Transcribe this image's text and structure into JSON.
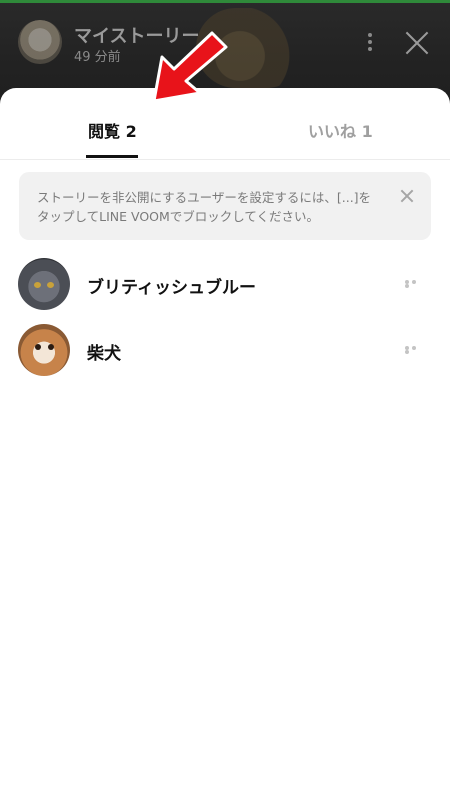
{
  "story": {
    "title": "マイストーリー",
    "time": "49 分前"
  },
  "tabs": [
    {
      "label": "閲覧 2",
      "selected": true
    },
    {
      "label": "いいね 1",
      "selected": false
    }
  ],
  "notice": {
    "text": "ストーリーを非公開にするユーザーを設定するには、[...]をタップしてLINE VOOMでブロックしてください。"
  },
  "viewers": [
    {
      "name": "ブリティッシュブルー",
      "avatar": "british-blue-cat"
    },
    {
      "name": "柴犬",
      "avatar": "shiba-dog"
    }
  ],
  "colors": {
    "accent_progress": "#2f8a3a",
    "annotation_arrow": "#e8131a",
    "selected_tab": "#111111",
    "unselected_tab": "#a0a0a0"
  }
}
